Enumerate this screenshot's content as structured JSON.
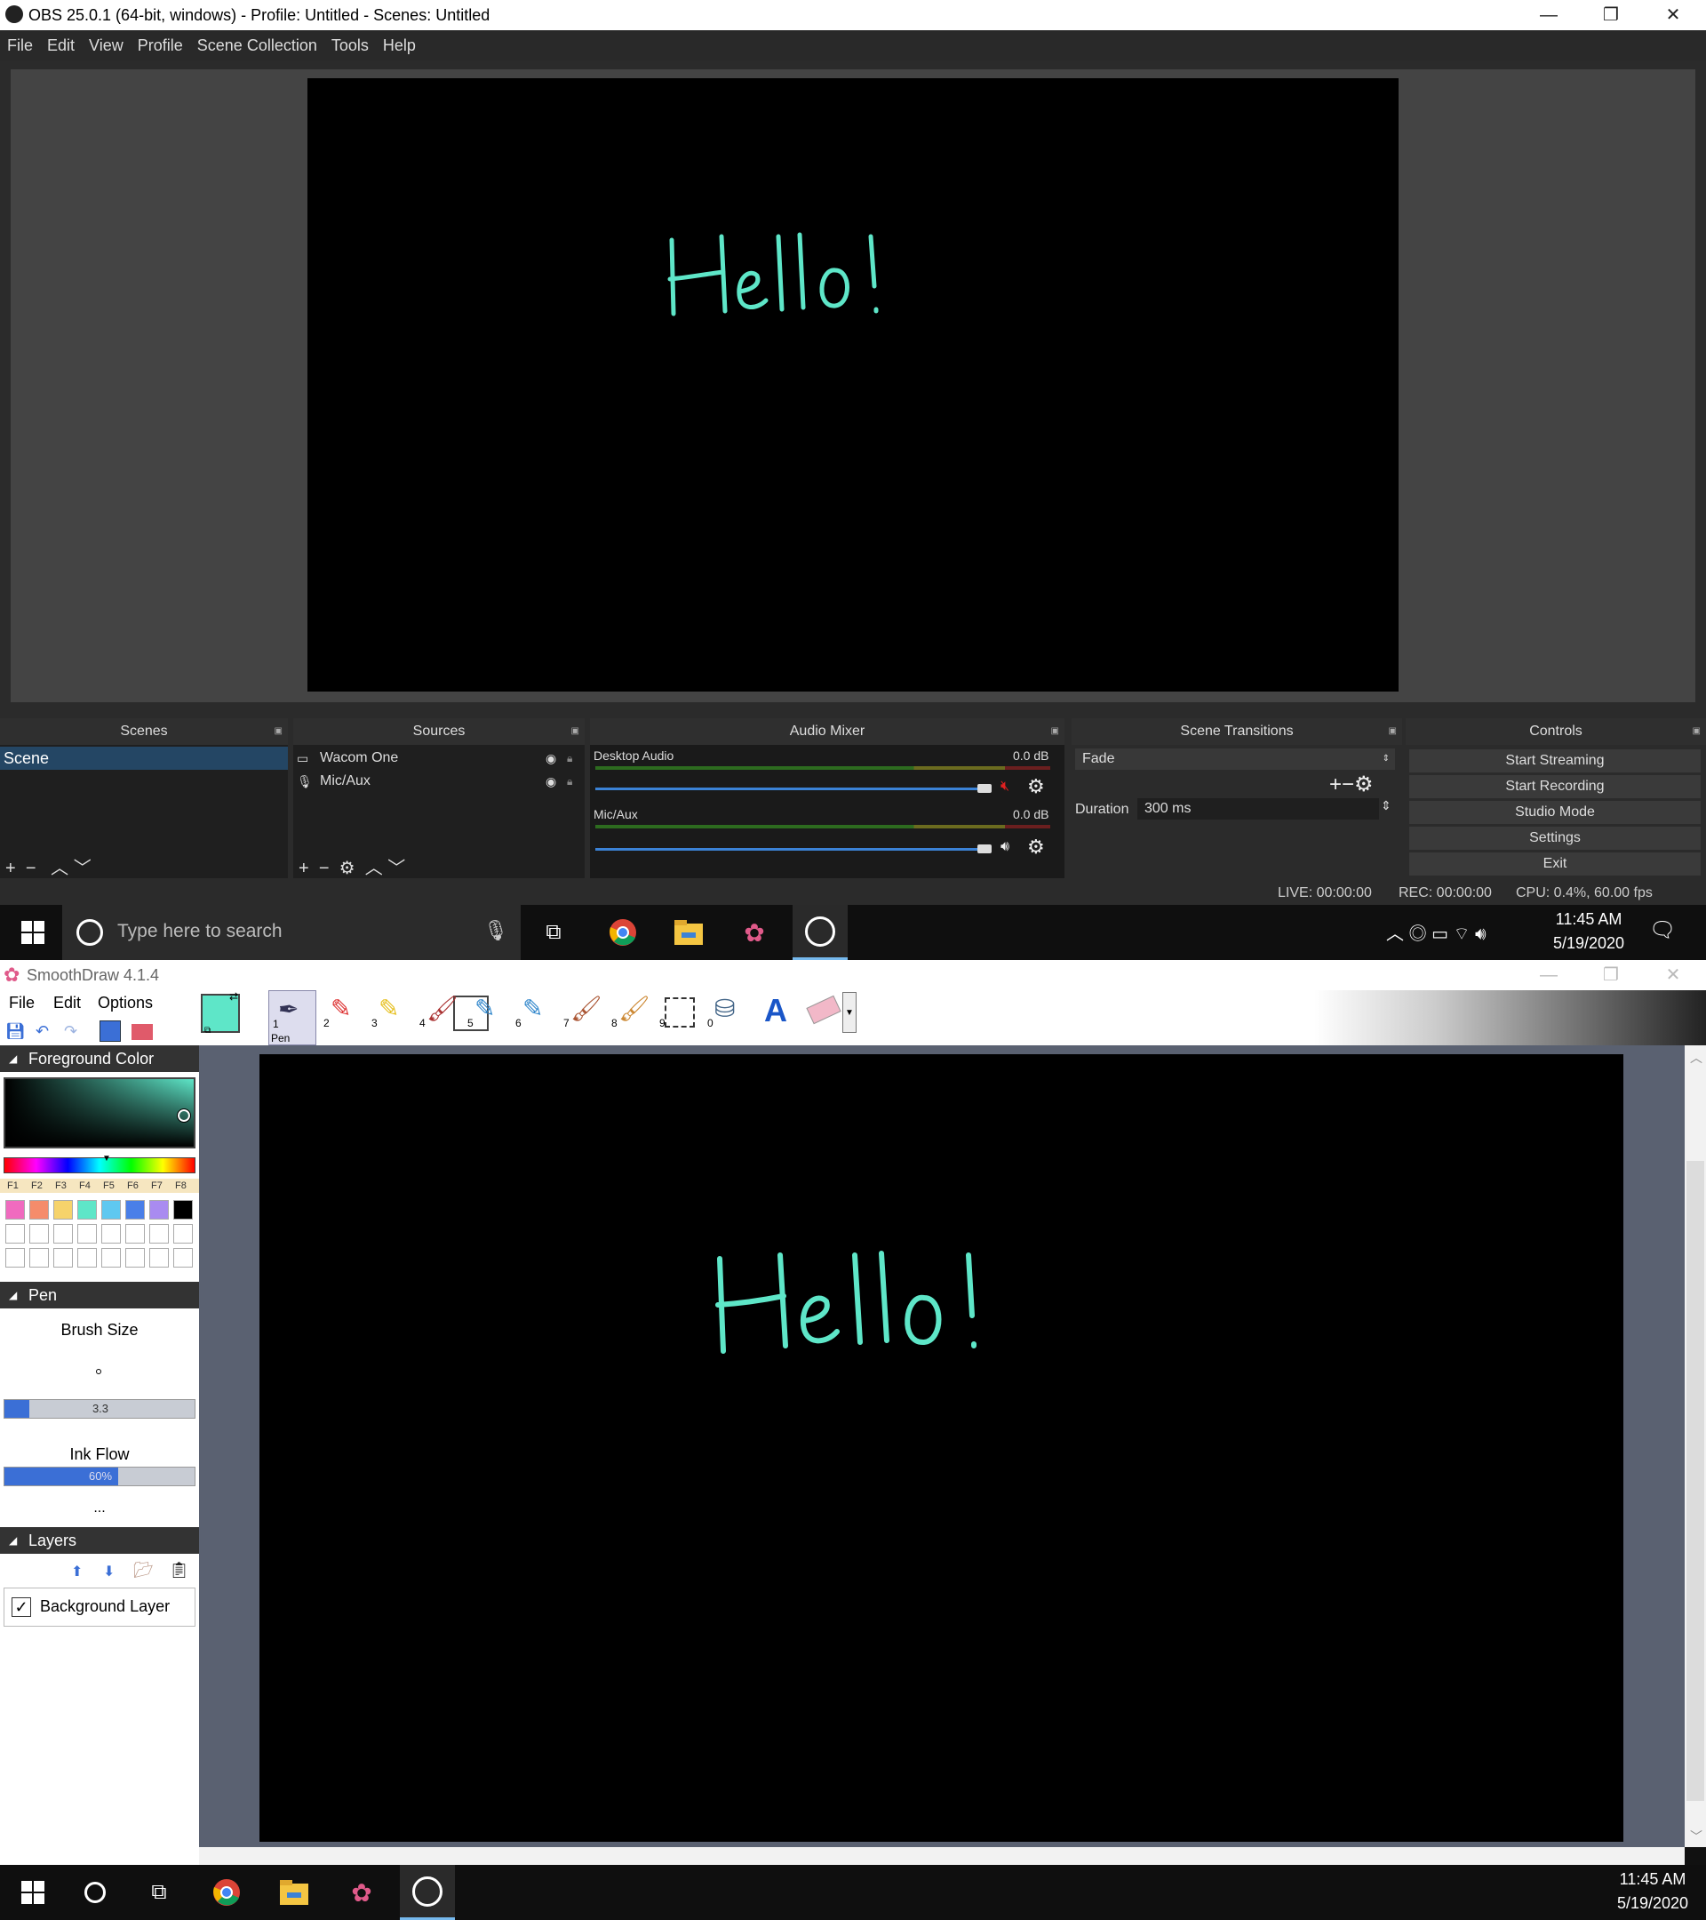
{
  "obs": {
    "title": "OBS 25.0.1 (64-bit, windows) - Profile: Untitled - Scenes: Untitled",
    "menu": [
      "File",
      "Edit",
      "View",
      "Profile",
      "Scene Collection",
      "Tools",
      "Help"
    ],
    "canvas_text": "Hello!",
    "docks": {
      "scenes": {
        "title": "Scenes",
        "items": [
          "Scene"
        ]
      },
      "sources": {
        "title": "Sources",
        "items": [
          "Wacom One",
          "Mic/Aux"
        ]
      },
      "audio": {
        "title": "Audio Mixer",
        "channels": [
          {
            "name": "Desktop Audio",
            "db": "0.0 dB",
            "muted": true
          },
          {
            "name": "Mic/Aux",
            "db": "0.0 dB",
            "muted": false
          }
        ]
      },
      "transitions": {
        "title": "Scene Transitions",
        "selected": "Fade",
        "duration_label": "Duration",
        "duration_value": "300 ms"
      },
      "controls": {
        "title": "Controls",
        "buttons": [
          "Start Streaming",
          "Start Recording",
          "Studio Mode",
          "Settings",
          "Exit"
        ]
      }
    },
    "status": {
      "live": "LIVE: 00:00:00",
      "rec": "REC: 00:00:00",
      "cpu": "CPU: 0.4%, 60.00 fps"
    }
  },
  "taskbar1": {
    "search_placeholder": "Type here to search",
    "time": "11:45 AM",
    "date": "5/19/2020"
  },
  "smoothdraw": {
    "title": "SmoothDraw 4.1.4",
    "menu": [
      "File",
      "Edit",
      "Options"
    ],
    "tool_numbers": [
      "1",
      "2",
      "3",
      "4",
      "5",
      "6",
      "7",
      "8",
      "9",
      "0"
    ],
    "active_tool": "Pen",
    "foreground_color": "#5ee6c8",
    "panels": {
      "fg": "Foreground Color",
      "fkeys": [
        "F1",
        "F2",
        "F3",
        "F4",
        "F5",
        "F6",
        "F7",
        "F8"
      ],
      "swatches": [
        "#f06bbf",
        "#f58c6b",
        "#f6d36b",
        "#5ee6c8",
        "#5fc8f0",
        "#4a7fe8",
        "#a98bf0",
        "#000000"
      ],
      "pen": "Pen",
      "brush_size_label": "Brush Size",
      "brush_size": "3.3",
      "ink_flow_label": "Ink Flow",
      "ink_flow": "60%",
      "more": "...",
      "layers": "Layers",
      "layer_name": "Background Layer"
    },
    "canvas_text": "Hello!"
  },
  "taskbar2": {
    "time": "11:45 AM",
    "date": "5/19/2020"
  }
}
